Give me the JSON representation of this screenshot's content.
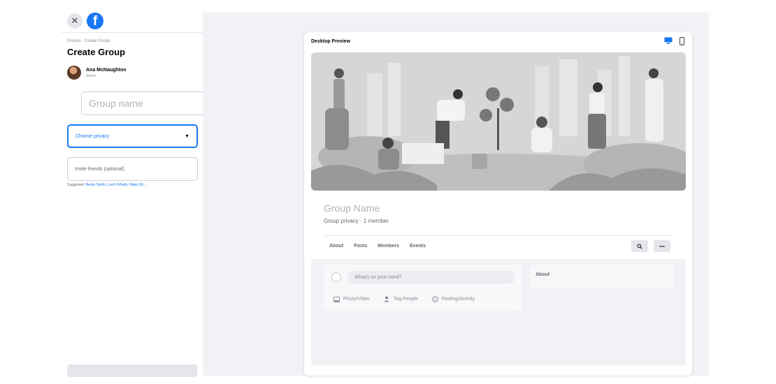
{
  "sidebar": {
    "breadcrumb": "Groups · Create Group",
    "title": "Create Group",
    "user": {
      "name": "Ana McNaughton",
      "role": "Admin"
    },
    "fields": {
      "group_name_placeholder": "Group name",
      "privacy_placeholder": "Choose privacy",
      "invite_placeholder": "Invite friends (optional)"
    },
    "suggested_label": "Suggested:",
    "suggested_names": "Becky Smith, Lurch Whalls, Haley Mc..."
  },
  "preview": {
    "title": "Desktop Preview",
    "group_name": "Group Name",
    "group_meta": "Group privacy · 1 member",
    "tabs": [
      "About",
      "Posts",
      "Members",
      "Events"
    ],
    "composer": {
      "placeholder": "What's on your mind?",
      "actions": [
        "Photo/Video",
        "Tag People",
        "Feeling/Activity"
      ]
    },
    "about_label": "About"
  },
  "colors": {
    "accent": "#1877f2",
    "page_bg": "#f0f2f5",
    "border": "#ced0d4"
  }
}
